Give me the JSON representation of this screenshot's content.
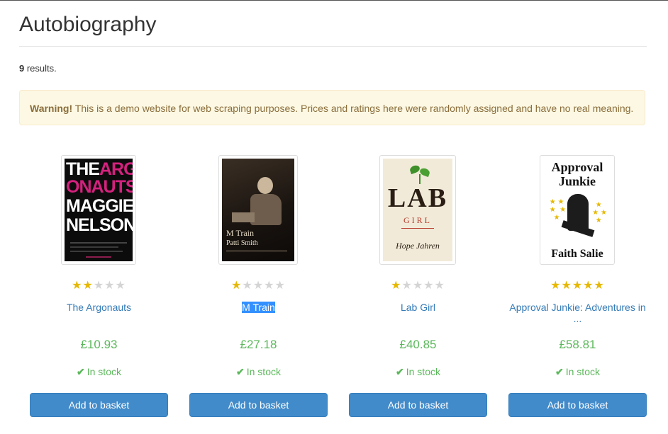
{
  "header": {
    "title": "Autobiography"
  },
  "results": {
    "count": "9",
    "suffix": " results."
  },
  "alert": {
    "strong": "Warning!",
    "text": " This is a demo website for web scraping purposes. Prices and ratings here were randomly assigned and have no real meaning."
  },
  "products": [
    {
      "title": "The Argonauts",
      "rating": 2,
      "price": "£10.93",
      "stock": "In stock",
      "button": "Add to basket",
      "cover": {
        "line1a": "THE",
        "line1b": "ARG",
        "line2": "ONAUTS",
        "line3": "MAGGIE",
        "line4": "NELSON"
      }
    },
    {
      "title": "M Train",
      "rating": 1,
      "price": "£27.18",
      "stock": "In stock",
      "button": "Add to basket",
      "cover": {
        "title": "M Train",
        "author": "Patti Smith"
      }
    },
    {
      "title": "Lab Girl",
      "rating": 1,
      "price": "£40.85",
      "stock": "In stock",
      "button": "Add to basket",
      "cover": {
        "title": "LAB",
        "subtitle": "GIRL",
        "author": "Hope Jahren"
      }
    },
    {
      "title": "Approval Junkie: Adventures in",
      "ellipsis": "...",
      "rating": 5,
      "price": "£58.81",
      "stock": "In stock",
      "button": "Add to basket",
      "cover": {
        "title1": "Approval",
        "title2": "Junkie",
        "author": "Faith Salie"
      }
    }
  ],
  "icons": {
    "star": "star-icon",
    "check": "check-icon"
  },
  "colors": {
    "price": "#5cb85c",
    "link": "#337ab7",
    "button": "#428bca",
    "star_on": "#e6b800",
    "star_off": "#d4d4d4"
  }
}
